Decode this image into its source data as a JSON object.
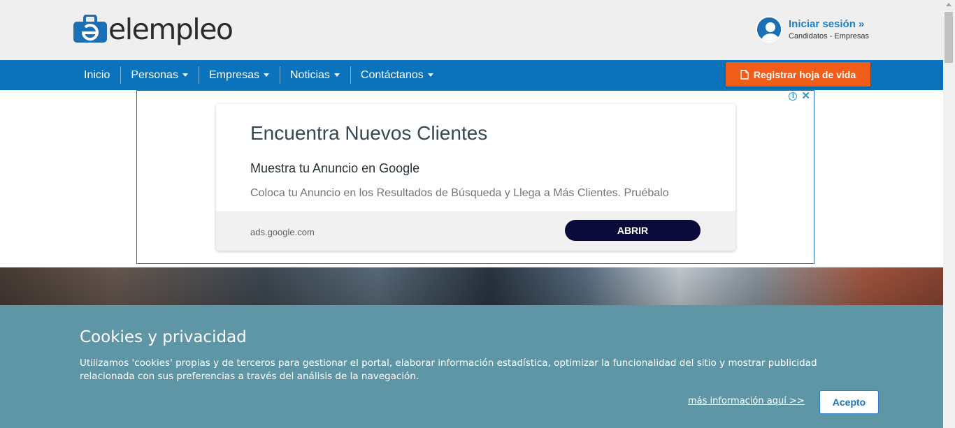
{
  "header": {
    "logo_text": "elempleo",
    "login_title": "Iniciar sesión »",
    "login_subtitle": "Candidatos - Empresas"
  },
  "nav": {
    "items": [
      {
        "label": "Inicio",
        "dropdown": false
      },
      {
        "label": "Personas",
        "dropdown": true
      },
      {
        "label": "Empresas",
        "dropdown": true
      },
      {
        "label": "Noticias",
        "dropdown": true
      },
      {
        "label": "Contáctanos",
        "dropdown": true
      }
    ],
    "register_button": "Registrar hoja de vida"
  },
  "ad": {
    "headline": "Encuentra Nuevos Clientes",
    "subheadline": "Muestra tu Anuncio en Google",
    "description": "Coloca tu Anuncio en los Resultados de Búsqueda y Llega a Más Clientes. Pruébalo",
    "url": "ads.google.com",
    "button": "ABRIR",
    "close_symbol": "✕",
    "info_symbol": "i"
  },
  "cookie": {
    "title": "Cookies y privacidad",
    "text": "Utilizamos 'cookies' propias y de terceros para gestionar el portal, elaborar información estadística, optimizar la funcionalidad del sitio y mostrar publicidad relacionada con sus preferencias a través del análisis de la navegación.",
    "more_link": "más información aquí >>",
    "accept_button": "Acepto"
  },
  "colors": {
    "brand_blue": "#0b73bc",
    "register_orange": "#f25c19",
    "cookie_bg": "#5f96a6",
    "ad_button": "#0b0b3b"
  },
  "icons": {
    "logo": "elempleo-briefcase-logo",
    "user": "user-avatar-icon",
    "document": "document-icon",
    "ad_info": "info-icon",
    "ad_close": "close-icon"
  }
}
